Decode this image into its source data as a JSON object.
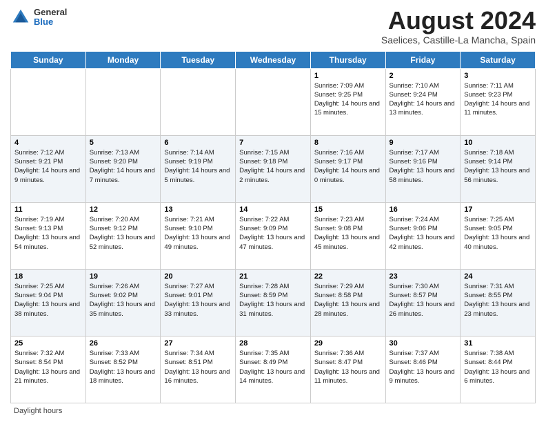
{
  "header": {
    "logo": {
      "general": "General",
      "blue": "Blue"
    },
    "title": "August 2024",
    "location": "Saelices, Castille-La Mancha, Spain"
  },
  "days_of_week": [
    "Sunday",
    "Monday",
    "Tuesday",
    "Wednesday",
    "Thursday",
    "Friday",
    "Saturday"
  ],
  "weeks": [
    [
      {
        "day": "",
        "info": ""
      },
      {
        "day": "",
        "info": ""
      },
      {
        "day": "",
        "info": ""
      },
      {
        "day": "",
        "info": ""
      },
      {
        "day": "1",
        "info": "Sunrise: 7:09 AM\nSunset: 9:25 PM\nDaylight: 14 hours and 15 minutes."
      },
      {
        "day": "2",
        "info": "Sunrise: 7:10 AM\nSunset: 9:24 PM\nDaylight: 14 hours and 13 minutes."
      },
      {
        "day": "3",
        "info": "Sunrise: 7:11 AM\nSunset: 9:23 PM\nDaylight: 14 hours and 11 minutes."
      }
    ],
    [
      {
        "day": "4",
        "info": "Sunrise: 7:12 AM\nSunset: 9:21 PM\nDaylight: 14 hours and 9 minutes."
      },
      {
        "day": "5",
        "info": "Sunrise: 7:13 AM\nSunset: 9:20 PM\nDaylight: 14 hours and 7 minutes."
      },
      {
        "day": "6",
        "info": "Sunrise: 7:14 AM\nSunset: 9:19 PM\nDaylight: 14 hours and 5 minutes."
      },
      {
        "day": "7",
        "info": "Sunrise: 7:15 AM\nSunset: 9:18 PM\nDaylight: 14 hours and 2 minutes."
      },
      {
        "day": "8",
        "info": "Sunrise: 7:16 AM\nSunset: 9:17 PM\nDaylight: 14 hours and 0 minutes."
      },
      {
        "day": "9",
        "info": "Sunrise: 7:17 AM\nSunset: 9:16 PM\nDaylight: 13 hours and 58 minutes."
      },
      {
        "day": "10",
        "info": "Sunrise: 7:18 AM\nSunset: 9:14 PM\nDaylight: 13 hours and 56 minutes."
      }
    ],
    [
      {
        "day": "11",
        "info": "Sunrise: 7:19 AM\nSunset: 9:13 PM\nDaylight: 13 hours and 54 minutes."
      },
      {
        "day": "12",
        "info": "Sunrise: 7:20 AM\nSunset: 9:12 PM\nDaylight: 13 hours and 52 minutes."
      },
      {
        "day": "13",
        "info": "Sunrise: 7:21 AM\nSunset: 9:10 PM\nDaylight: 13 hours and 49 minutes."
      },
      {
        "day": "14",
        "info": "Sunrise: 7:22 AM\nSunset: 9:09 PM\nDaylight: 13 hours and 47 minutes."
      },
      {
        "day": "15",
        "info": "Sunrise: 7:23 AM\nSunset: 9:08 PM\nDaylight: 13 hours and 45 minutes."
      },
      {
        "day": "16",
        "info": "Sunrise: 7:24 AM\nSunset: 9:06 PM\nDaylight: 13 hours and 42 minutes."
      },
      {
        "day": "17",
        "info": "Sunrise: 7:25 AM\nSunset: 9:05 PM\nDaylight: 13 hours and 40 minutes."
      }
    ],
    [
      {
        "day": "18",
        "info": "Sunrise: 7:25 AM\nSunset: 9:04 PM\nDaylight: 13 hours and 38 minutes."
      },
      {
        "day": "19",
        "info": "Sunrise: 7:26 AM\nSunset: 9:02 PM\nDaylight: 13 hours and 35 minutes."
      },
      {
        "day": "20",
        "info": "Sunrise: 7:27 AM\nSunset: 9:01 PM\nDaylight: 13 hours and 33 minutes."
      },
      {
        "day": "21",
        "info": "Sunrise: 7:28 AM\nSunset: 8:59 PM\nDaylight: 13 hours and 31 minutes."
      },
      {
        "day": "22",
        "info": "Sunrise: 7:29 AM\nSunset: 8:58 PM\nDaylight: 13 hours and 28 minutes."
      },
      {
        "day": "23",
        "info": "Sunrise: 7:30 AM\nSunset: 8:57 PM\nDaylight: 13 hours and 26 minutes."
      },
      {
        "day": "24",
        "info": "Sunrise: 7:31 AM\nSunset: 8:55 PM\nDaylight: 13 hours and 23 minutes."
      }
    ],
    [
      {
        "day": "25",
        "info": "Sunrise: 7:32 AM\nSunset: 8:54 PM\nDaylight: 13 hours and 21 minutes."
      },
      {
        "day": "26",
        "info": "Sunrise: 7:33 AM\nSunset: 8:52 PM\nDaylight: 13 hours and 18 minutes."
      },
      {
        "day": "27",
        "info": "Sunrise: 7:34 AM\nSunset: 8:51 PM\nDaylight: 13 hours and 16 minutes."
      },
      {
        "day": "28",
        "info": "Sunrise: 7:35 AM\nSunset: 8:49 PM\nDaylight: 13 hours and 14 minutes."
      },
      {
        "day": "29",
        "info": "Sunrise: 7:36 AM\nSunset: 8:47 PM\nDaylight: 13 hours and 11 minutes."
      },
      {
        "day": "30",
        "info": "Sunrise: 7:37 AM\nSunset: 8:46 PM\nDaylight: 13 hours and 9 minutes."
      },
      {
        "day": "31",
        "info": "Sunrise: 7:38 AM\nSunset: 8:44 PM\nDaylight: 13 hours and 6 minutes."
      }
    ]
  ],
  "footer": {
    "note": "Daylight hours"
  }
}
